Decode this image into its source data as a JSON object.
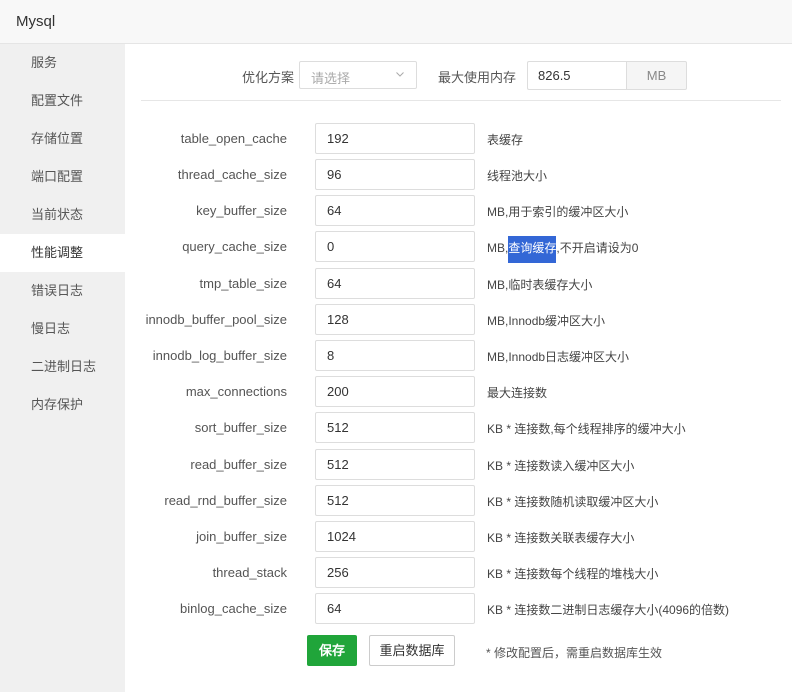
{
  "window": {
    "title": "Mysql"
  },
  "sidebar": {
    "items": [
      {
        "label": "服务"
      },
      {
        "label": "配置文件"
      },
      {
        "label": "存储位置"
      },
      {
        "label": "端口配置"
      },
      {
        "label": "当前状态"
      },
      {
        "label": "性能调整",
        "active": true
      },
      {
        "label": "错误日志"
      },
      {
        "label": "慢日志"
      },
      {
        "label": "二进制日志"
      },
      {
        "label": "内存保护"
      }
    ]
  },
  "optimize": {
    "label": "优化方案",
    "placeholder": "请选择",
    "max_mem_label": "最大使用内存",
    "max_mem_value": "826.5",
    "max_mem_unit": "MB"
  },
  "params": [
    {
      "name": "table_open_cache",
      "value": "192",
      "desc": "表缓存"
    },
    {
      "name": "thread_cache_size",
      "value": "96",
      "desc": "线程池大小"
    },
    {
      "name": "key_buffer_size",
      "value": "64",
      "desc": "MB,用于索引的缓冲区大小"
    },
    {
      "name": "query_cache_size",
      "value": "0",
      "desc_pre": "MB,",
      "desc_hl": "查询缓存",
      "desc_post": ",不开启请设为0"
    },
    {
      "name": "tmp_table_size",
      "value": "64",
      "desc": "MB,临时表缓存大小"
    },
    {
      "name": "innodb_buffer_pool_size",
      "value": "128",
      "desc": "MB,Innodb缓冲区大小"
    },
    {
      "name": "innodb_log_buffer_size",
      "value": "8",
      "desc": "MB,Innodb日志缓冲区大小"
    },
    {
      "name": "max_connections",
      "value": "200",
      "desc": "最大连接数"
    },
    {
      "name": "sort_buffer_size",
      "value": "512",
      "desc": "KB * 连接数,每个线程排序的缓冲大小"
    },
    {
      "name": "read_buffer_size",
      "value": "512",
      "desc": "KB * 连接数读入缓冲区大小"
    },
    {
      "name": "read_rnd_buffer_size",
      "value": "512",
      "desc": "KB * 连接数随机读取缓冲区大小"
    },
    {
      "name": "join_buffer_size",
      "value": "1024",
      "desc": "KB * 连接数关联表缓存大小"
    },
    {
      "name": "thread_stack",
      "value": "256",
      "desc": "KB * 连接数每个线程的堆栈大小"
    },
    {
      "name": "binlog_cache_size",
      "value": "64",
      "desc": "KB * 连接数二进制日志缓存大小(4096的倍数)"
    }
  ],
  "actions": {
    "save_label": "保存",
    "restart_label": "重启数据库",
    "note": "* 修改配置后，需重启数据库生效"
  },
  "colors": {
    "primary": "#20a53a",
    "highlight": "#3367d6",
    "sidebar_bg": "#f0f0f0"
  }
}
